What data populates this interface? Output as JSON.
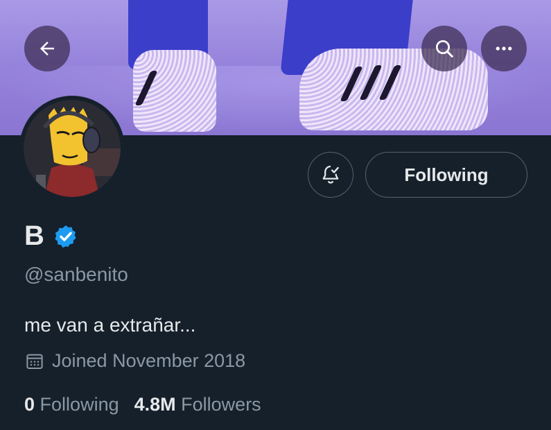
{
  "header": {
    "back_icon": "arrow-left-icon",
    "search_icon": "search-icon",
    "more_icon": "more-horizontal-icon"
  },
  "profile": {
    "display_name": "B",
    "verified": true,
    "handle": "@sanbenito",
    "bio": "me van a extrañar...",
    "joined": "Joined November 2018",
    "following_count": "0",
    "following_label": "Following",
    "followers_count": "4.8M",
    "followers_label": "Followers"
  },
  "actions": {
    "follow_button_label": "Following",
    "notifications_icon": "bell-check-icon"
  },
  "colors": {
    "background": "#15202b",
    "secondary_text": "#8b98a5",
    "primary_text": "#e7e9ea",
    "verified_blue": "#1d9bf0"
  }
}
